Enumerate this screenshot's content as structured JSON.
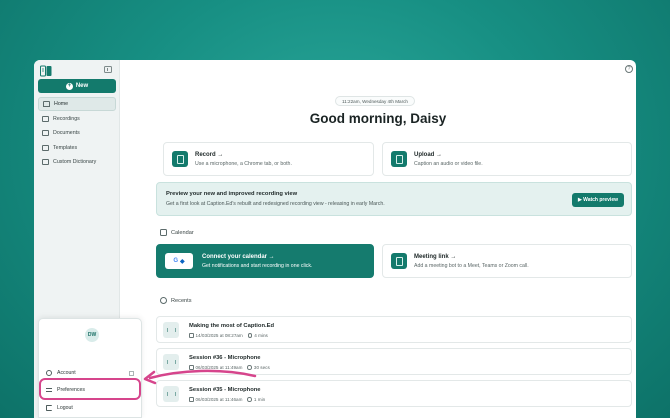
{
  "sidebar": {
    "new_label": "New",
    "items": [
      {
        "label": "Home"
      },
      {
        "label": "Recordings"
      },
      {
        "label": "Documents"
      },
      {
        "label": "Templates"
      },
      {
        "label": "Custom Dictionary"
      }
    ]
  },
  "user_menu": {
    "initials": "DW",
    "account": "Account",
    "preferences": "Preferences",
    "logout": "Logout"
  },
  "main": {
    "date": "11:22am, Wednesday 4th March",
    "greeting": "Good morning, Daisy",
    "actions": [
      {
        "title": "Record →",
        "subtitle": "Use a microphone, a Chrome tab, or both."
      },
      {
        "title": "Upload →",
        "subtitle": "Caption an audio or video file."
      }
    ],
    "banner": {
      "title": "Preview your new and improved recording view",
      "subtitle": "Get a first look at Caption.Ed's rebuilt and redesigned recording view - releasing in early March.",
      "button": "▶ Watch preview"
    },
    "calendar_heading": "Calendar",
    "calendar_cards": [
      {
        "title": "Connect your calendar →",
        "subtitle": "Get notifications and start recording in one click."
      },
      {
        "title": "Meeting link →",
        "subtitle": "Add a meeting bot to a Meet, Teams or Zoom call."
      }
    ],
    "recents_heading": "Recents",
    "recents": [
      {
        "title": "Making the most of Caption.Ed",
        "date": "14/03/2025 at 08:27am",
        "duration": "4 mins"
      },
      {
        "title": "Session #36 - Microphone",
        "date": "06/03/2025 at 11:49am",
        "duration": "30 secs"
      },
      {
        "title": "Session #35 - Microphone",
        "date": "06/03/2025 at 11:46am",
        "duration": "1 min"
      }
    ]
  },
  "colors": {
    "background": "#178f83",
    "accent": "#137a6c",
    "highlight": "#d6458c",
    "banner_bg": "#e4f1ef"
  }
}
